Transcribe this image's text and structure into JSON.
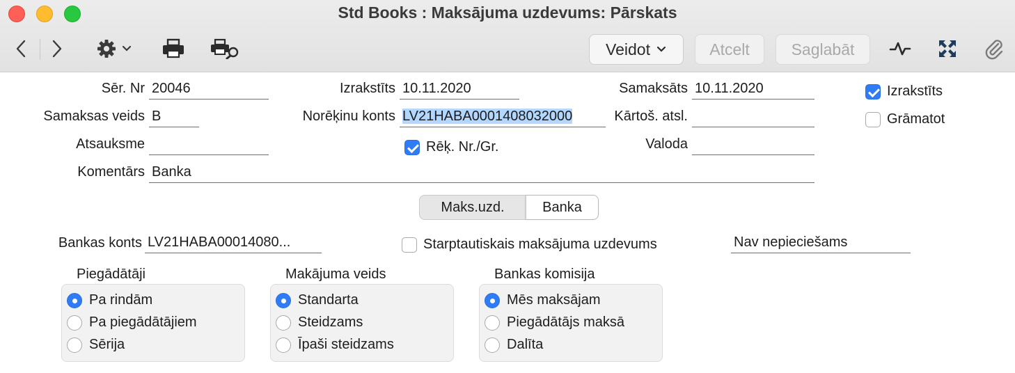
{
  "window": {
    "title": "Std Books : Maksājuma uzdevums: Pārskats"
  },
  "toolbar": {
    "icons": [
      "back-icon",
      "forward-icon",
      "gear-icon",
      "chevron-down-icon",
      "print-icon",
      "print-preview-icon",
      "activity-icon",
      "fullscreen-icon",
      "attachment-icon"
    ],
    "create_label": "Veidot",
    "cancel_label": "Atcelt",
    "save_label": "Saglabāt"
  },
  "form": {
    "ser_nr": {
      "label": "Sēr. Nr",
      "value": "20046"
    },
    "issued": {
      "label": "Izrakstīts",
      "value": "10.11.2020"
    },
    "paid": {
      "label": "Samaksāts",
      "value": "10.11.2020"
    },
    "payment_type": {
      "label": "Samaksas veids",
      "value": "B"
    },
    "account": {
      "label": "Norēķinu konts",
      "value": "LV21HABA0001408032000"
    },
    "sort_key": {
      "label": "Kārtoš. atsl.",
      "value": ""
    },
    "reference": {
      "label": "Atsauksme",
      "value": ""
    },
    "language": {
      "label": "Valoda",
      "value": ""
    },
    "comment": {
      "label": "Komentārs",
      "value": "Banka"
    },
    "invoice_nr_checkbox": {
      "label": "Rēķ. Nr./Gr.",
      "checked": true
    },
    "issued_checkbox": {
      "label": "Izrakstīts",
      "checked": true
    },
    "post_checkbox": {
      "label": "Grāmatot",
      "checked": false
    }
  },
  "tabs": [
    {
      "label": "Maks.uzd.",
      "selected": false
    },
    {
      "label": "Banka",
      "selected": true
    }
  ],
  "bank": {
    "bank_account": {
      "label": "Bankas konts",
      "value": "LV21HABA00014080..."
    },
    "international": {
      "label": "Starptautiskais maksājuma uzdevums",
      "checked": false
    },
    "requirement": {
      "value": "Nav nepieciešams"
    },
    "suppliers": {
      "title": "Piegādātāji",
      "options": [
        "Pa rindām",
        "Pa piegādātājiem",
        "Sērija"
      ],
      "selected": 0
    },
    "payment_type": {
      "title": "Makājuma veids",
      "options": [
        "Standarta",
        "Steidzams",
        "Īpaši steidzams"
      ],
      "selected": 0
    },
    "commission": {
      "title": "Bankas komisija",
      "options": [
        "Mēs maksājam",
        "Piegādātājs maksā",
        "Dalīta"
      ],
      "selected": 0
    }
  }
}
